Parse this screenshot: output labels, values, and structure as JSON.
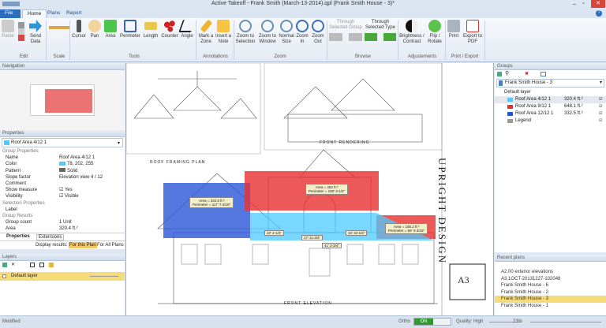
{
  "window": {
    "title": "Active Takeoff - Frank Smith (March-13-2014).qpl (Frank Smith House - 3)*"
  },
  "tabs": [
    {
      "label": "File"
    },
    {
      "label": "Home"
    },
    {
      "label": "Plans"
    },
    {
      "label": "Report"
    }
  ],
  "ribbon": {
    "edit": {
      "label": "Edit",
      "paste": "Paste",
      "send_data": "Send Data"
    },
    "scale": {
      "label": "Scale"
    },
    "tools": {
      "label": "Tools",
      "items": [
        "Cursor",
        "Pan",
        "Area",
        "Perimeter",
        "Length",
        "Counter",
        "Angle"
      ]
    },
    "annotations": {
      "label": "Annotations",
      "items": [
        "Mark a Zone",
        "Insert a Note"
      ]
    },
    "zoom": {
      "label": "Zoom",
      "items": [
        "Zoom to Selection",
        "Zoom to Window",
        "Normal Size",
        "Zoom In",
        "Zoom Out"
      ]
    },
    "browse": {
      "label": "Browse",
      "through_group": "Through Selected Group",
      "through_type": "Through Selected Type"
    },
    "adjustments": {
      "label": "Adjustements",
      "items": [
        "Brightness / Contrast",
        "Flip / Rotate"
      ]
    },
    "print": {
      "label": "Print / Export",
      "items": [
        "Print",
        "Export to PDF"
      ]
    }
  },
  "navigation": {
    "title": "Navigation"
  },
  "properties": {
    "title": "Properties",
    "selected": "Roof Area 4/12 1",
    "rows": [
      {
        "type": "section",
        "label": "Group Properties"
      },
      {
        "label": "Name",
        "value": "Roof Area 4/12 1"
      },
      {
        "label": "Color",
        "value": "78, 202, 255",
        "swatch": "#4ecaff"
      },
      {
        "label": "Pattern",
        "value": "Solid",
        "swatch": "#666666"
      },
      {
        "label": "Slope factor",
        "value": "Elevation view 4 / 12"
      },
      {
        "label": "Comment",
        "value": ""
      },
      {
        "label": "Show measure",
        "value": "Yes",
        "check": true
      },
      {
        "label": "Visibility",
        "value": "Visible",
        "check": true
      },
      {
        "type": "section",
        "label": "Selection Properties"
      },
      {
        "label": "Label",
        "value": ""
      },
      {
        "type": "section",
        "label": "Group Results"
      },
      {
        "label": "Group count",
        "value": "1 Unit"
      },
      {
        "label": "Area",
        "value": "320.4 ft.²"
      }
    ],
    "tabs": [
      "Properties",
      "Extensions"
    ],
    "display_results_label": "Display results:",
    "for_this_plan": "For this Plan",
    "for_all_plans": "For All Plans"
  },
  "layers": {
    "title": "Layers",
    "items": [
      {
        "label": "Default layer"
      }
    ]
  },
  "groups": {
    "title": "Groups",
    "plan": "Frank Smith House - 3",
    "layer": "Default layer",
    "items": [
      {
        "name": "Roof Area 4/12 1",
        "value": "320.4 ft.²",
        "color": "#4ecaff"
      },
      {
        "name": "Roof Area 9/12 1",
        "value": "648.1 ft.²",
        "color": "#e83030"
      },
      {
        "name": "Roof Area 12/12 1",
        "value": "332.5 ft.²",
        "color": "#2a55d8"
      },
      {
        "name": "Legend",
        "value": ""
      }
    ]
  },
  "recent_plans": {
    "title": "Recent plans",
    "items": [
      "A2.00 exterior elevations",
      "A3.1OCT-20131227-102048",
      "Frank Smith House - 6",
      "Frank Smith House - 2",
      "Frank Smith House - 3",
      "Frank Smith House - 1"
    ],
    "selected": 4
  },
  "drawing": {
    "labels": [
      "ROOF FRAMING PLAN",
      "FRONT RENDERING",
      "FRONT ELEVATION",
      "UPRIGHT DESIGN",
      "A3"
    ],
    "callouts": [
      {
        "area": "Area = 332.5 ft.²",
        "perimeter": "Perimeter = 117' 7-3/16\""
      },
      {
        "area": "Area = 462 ft.²",
        "perimeter": "Perimeter = 150' 3-1/2\""
      },
      {
        "area": "Area = 185.2 ft.²",
        "perimeter": "Perimeter = 59' 3-3/16\""
      }
    ],
    "dims": [
      "10' 2-1/4\"",
      "10' 10-1/2\"",
      "17' 11-3/4\"",
      "41' 2-3/4\""
    ]
  },
  "status": {
    "left": "Modified",
    "ortho_label": "Ortho",
    "ortho_value": "ON",
    "quality": "Quality: High",
    "zoom": "23%"
  }
}
